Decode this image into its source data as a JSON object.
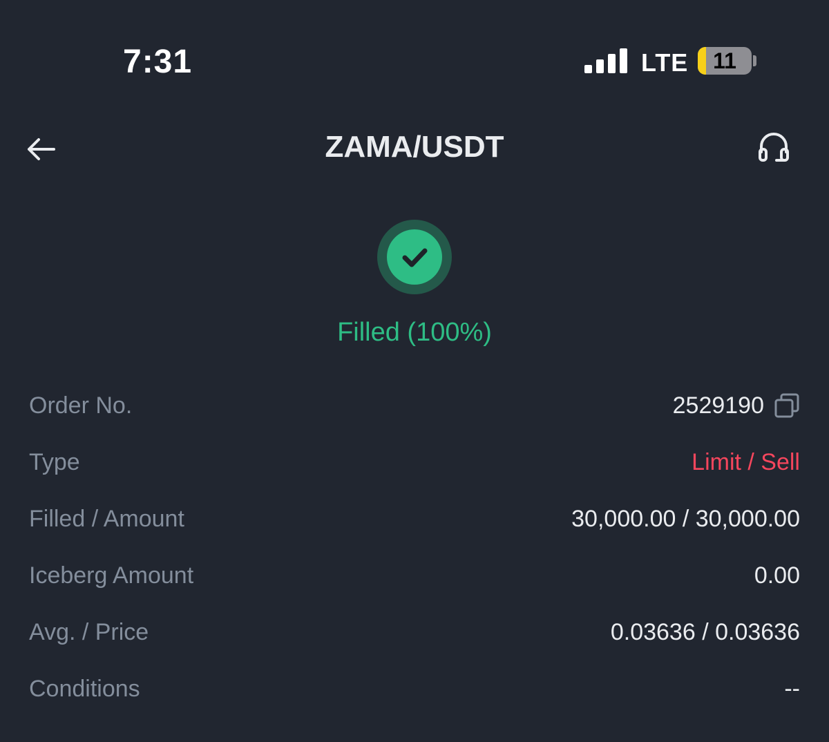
{
  "status_bar": {
    "time": "7:31",
    "network": "LTE",
    "battery": "11",
    "battery_color": "#f7d01a"
  },
  "header": {
    "title": "ZAMA/USDT",
    "back_icon": "arrow-left-icon",
    "support_icon": "headset-icon"
  },
  "order_status": {
    "icon": "check-circle-icon",
    "text": "Filled (100%)",
    "color": "#2ebd85"
  },
  "details": [
    {
      "label": "Order No.",
      "value": "2529190"
    },
    {
      "label": "Type",
      "value": "Limit / Sell",
      "color": "#f6465d"
    },
    {
      "label": "Filled / Amount",
      "value": "30,000.00 / 30,000.00"
    },
    {
      "label": "Iceberg Amount",
      "value": "0.00"
    },
    {
      "label": "Avg. / Price",
      "value": "0.03636 / 0.03636"
    },
    {
      "label": "Conditions",
      "value": "--"
    }
  ]
}
